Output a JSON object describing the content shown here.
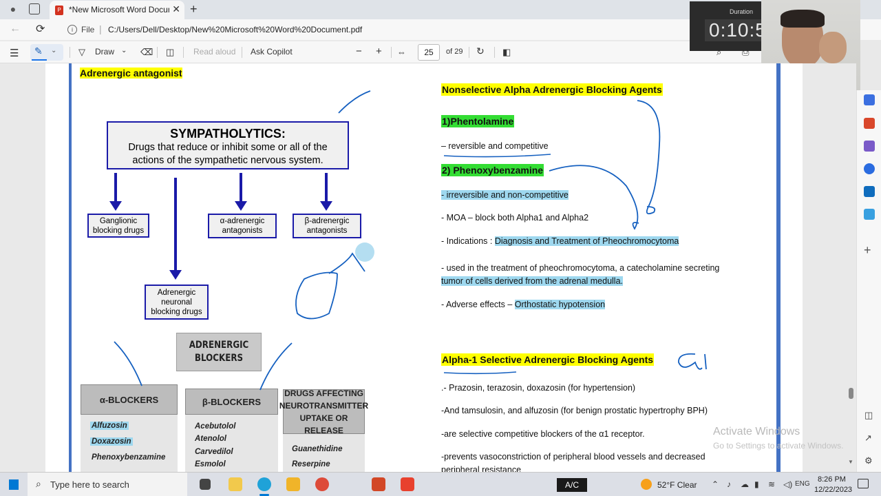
{
  "browser": {
    "tab_title": "*New Microsoft Word Document",
    "url_scheme_label": "File",
    "url_path": "C:/Users/Dell/Desktop/New%20Microsoft%20Word%20Document.pdf"
  },
  "pdf_toolbar": {
    "draw_label": "Draw",
    "read_aloud_label": "Read aloud",
    "ask_copilot_label": "Ask Copilot",
    "zoom_out": "−",
    "zoom_in": "+",
    "page_current": "25",
    "page_total": "of 29"
  },
  "recorder": {
    "duration_label": "Duration",
    "duration_time": "0:10:5"
  },
  "document": {
    "left": {
      "heading": "Adrenergic antagonist",
      "sympatholytics_title": "SYMPATHOLYTICS:",
      "sympatholytics_line1": "Drugs that reduce or inhibit some or all of the",
      "sympatholytics_line2": "actions of the sympathetic nervous system.",
      "box_ganglionic_1": "Ganglionic",
      "box_ganglionic_2": "blocking drugs",
      "box_alpha_1": "α-adrenergic",
      "box_alpha_2": "antagonists",
      "box_beta_1": "β-adrenergic",
      "box_beta_2": "antagonists",
      "box_neuronal_1": "Adrenergic",
      "box_neuronal_2": "neuronal",
      "box_neuronal_3": "blocking drugs",
      "blockers_1": "ADRENERGIC",
      "blockers_2": "BLOCKERS",
      "alpha_blockers": "α-BLOCKERS",
      "beta_blockers": "β-BLOCKERS",
      "neuro_1": "DRUGS AFFECTING",
      "neuro_2": "NEUROTRANSMITTER",
      "neuro_3": "UPTAKE OR RELEASE",
      "alpha_drugs": [
        "Alfuzosin",
        "Doxazosin",
        "Phenoxybenzamine"
      ],
      "beta_drugs": [
        "Acebutolol",
        "Atenolol",
        "Carvedilol",
        "Esmolol"
      ],
      "neuro_drugs": [
        "Guanethidine",
        "Reserpine"
      ]
    },
    "right": {
      "heading1": "Nonselective Alpha Adrenergic Blocking Agents",
      "phentolamine": "1)Phentolamine",
      "phentolamine_desc": "– reversible and competitive",
      "phenoxy": "2) Phenoxybenzamine",
      "irreversible": "- irreversible and non-competitive",
      "moa": "- MOA – block both Alpha1 and Alpha2",
      "indications_label": "- Indications : ",
      "indications_value": "Diagnosis and Treatment of Pheochromocytoma",
      "used_line1": " - used in the treatment of pheochromocytoma, a catecholamine secreting",
      "used_line2": "tumor of cells derived from the adrenal medulla.",
      "adverse_label": "- Adverse effects – ",
      "adverse_value": "Orthostatic hypotension",
      "heading2": "Alpha-1 Selective Adrenergic Blocking Agents",
      "drugs_line": ".-  Prazosin, terazosin, doxazosin (for hypertension)",
      "and_line": "-And tamsulosin, and alfuzosin (for benign prostatic hypertrophy BPH)",
      "selective_line": "-are selective competitive blockers of the α1 receptor.",
      "prevents_line1": "-prevents vasoconstriction of peripheral blood vessels and decreased",
      "prevents_line2": "peripheral resistance"
    }
  },
  "watermark": {
    "line1": "Activate Windows",
    "line2": "Go to Settings to activate Windows."
  },
  "taskbar": {
    "search_placeholder": "Type here to search",
    "ac_label": "A/C",
    "weather": "52°F  Clear",
    "language": "ENG",
    "time": "8:26 PM",
    "date": "12/22/2023"
  },
  "colors": {
    "highlight_yellow": "#ffff00",
    "highlight_green": "#33dd33",
    "highlight_blue": "#9ed8ef",
    "diagram_blue": "#1a1aa8",
    "annotation_blue": "#1560c0"
  }
}
